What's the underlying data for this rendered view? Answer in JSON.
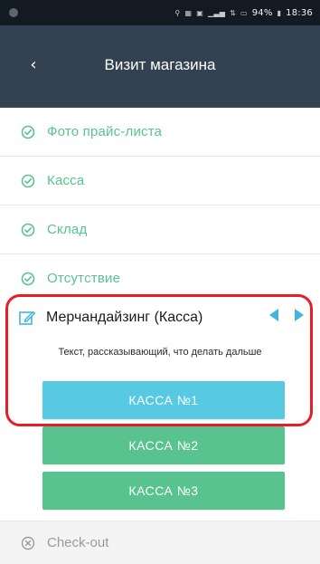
{
  "status_bar": {
    "time": "18:36",
    "battery": "94%"
  },
  "app_bar": {
    "back_icon": "chevron-left-icon",
    "title": "Визит магазина",
    "background_color": "#334150"
  },
  "menu": {
    "items": [
      {
        "label": "Фото прайс-листа",
        "icon": "check-circle-icon",
        "status": "done"
      },
      {
        "label": "Касса",
        "icon": "check-circle-icon",
        "status": "done"
      },
      {
        "label": "Склад",
        "icon": "check-circle-icon",
        "status": "done"
      },
      {
        "label": "Отсутствие",
        "icon": "check-circle-icon",
        "status": "done"
      }
    ],
    "done_color": "#59c38f"
  },
  "merchandising": {
    "title": "Мерчандайзинг (Касса)",
    "edit_icon": "edit-icon",
    "prev_icon": "arrow-left-icon",
    "next_icon": "arrow-right-icon",
    "nav_color": "#45b2e0",
    "description": "Текст, рассказывающий, что делать дальше",
    "buttons": [
      {
        "label": "КАССА №1",
        "color": "#57c9e3",
        "active": true
      },
      {
        "label": "КАССА №2",
        "color": "#59c38f",
        "active": false
      },
      {
        "label": "КАССА №3",
        "color": "#59c38f",
        "active": false
      }
    ]
  },
  "checkout": {
    "label": "Check-out",
    "icon": "close-circle-icon"
  },
  "highlight_color": "#e32025"
}
